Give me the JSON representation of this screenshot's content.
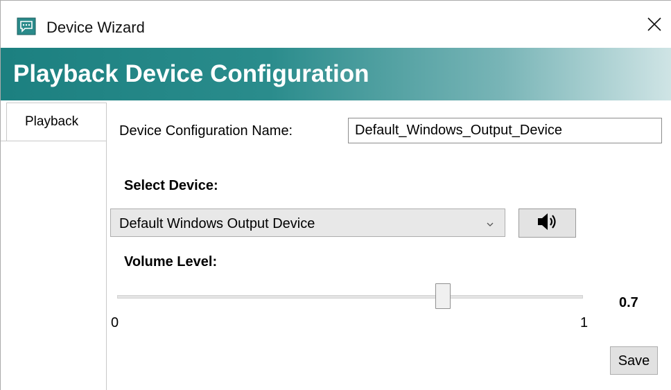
{
  "window": {
    "title": "Device Wizard",
    "icon": "speech-bubble-icon",
    "close_icon": "close-icon"
  },
  "header": {
    "title": "Playback Device Configuration",
    "gradient_start": "#1c8080",
    "gradient_end": "#cfe4e5"
  },
  "tabs": [
    {
      "label": "Playback",
      "selected": true
    }
  ],
  "form": {
    "config_name_label": "Device Configuration Name:",
    "config_name_value": "Default_Windows_Output_Device",
    "select_device_label": "Select Device:",
    "selected_device": "Default Windows Output Device",
    "test_sound_icon": "speaker-icon",
    "volume_label": "Volume Level:",
    "volume": {
      "min": "0",
      "max": "1",
      "value": 0.7,
      "value_text": "0.7"
    },
    "save_label": "Save"
  }
}
